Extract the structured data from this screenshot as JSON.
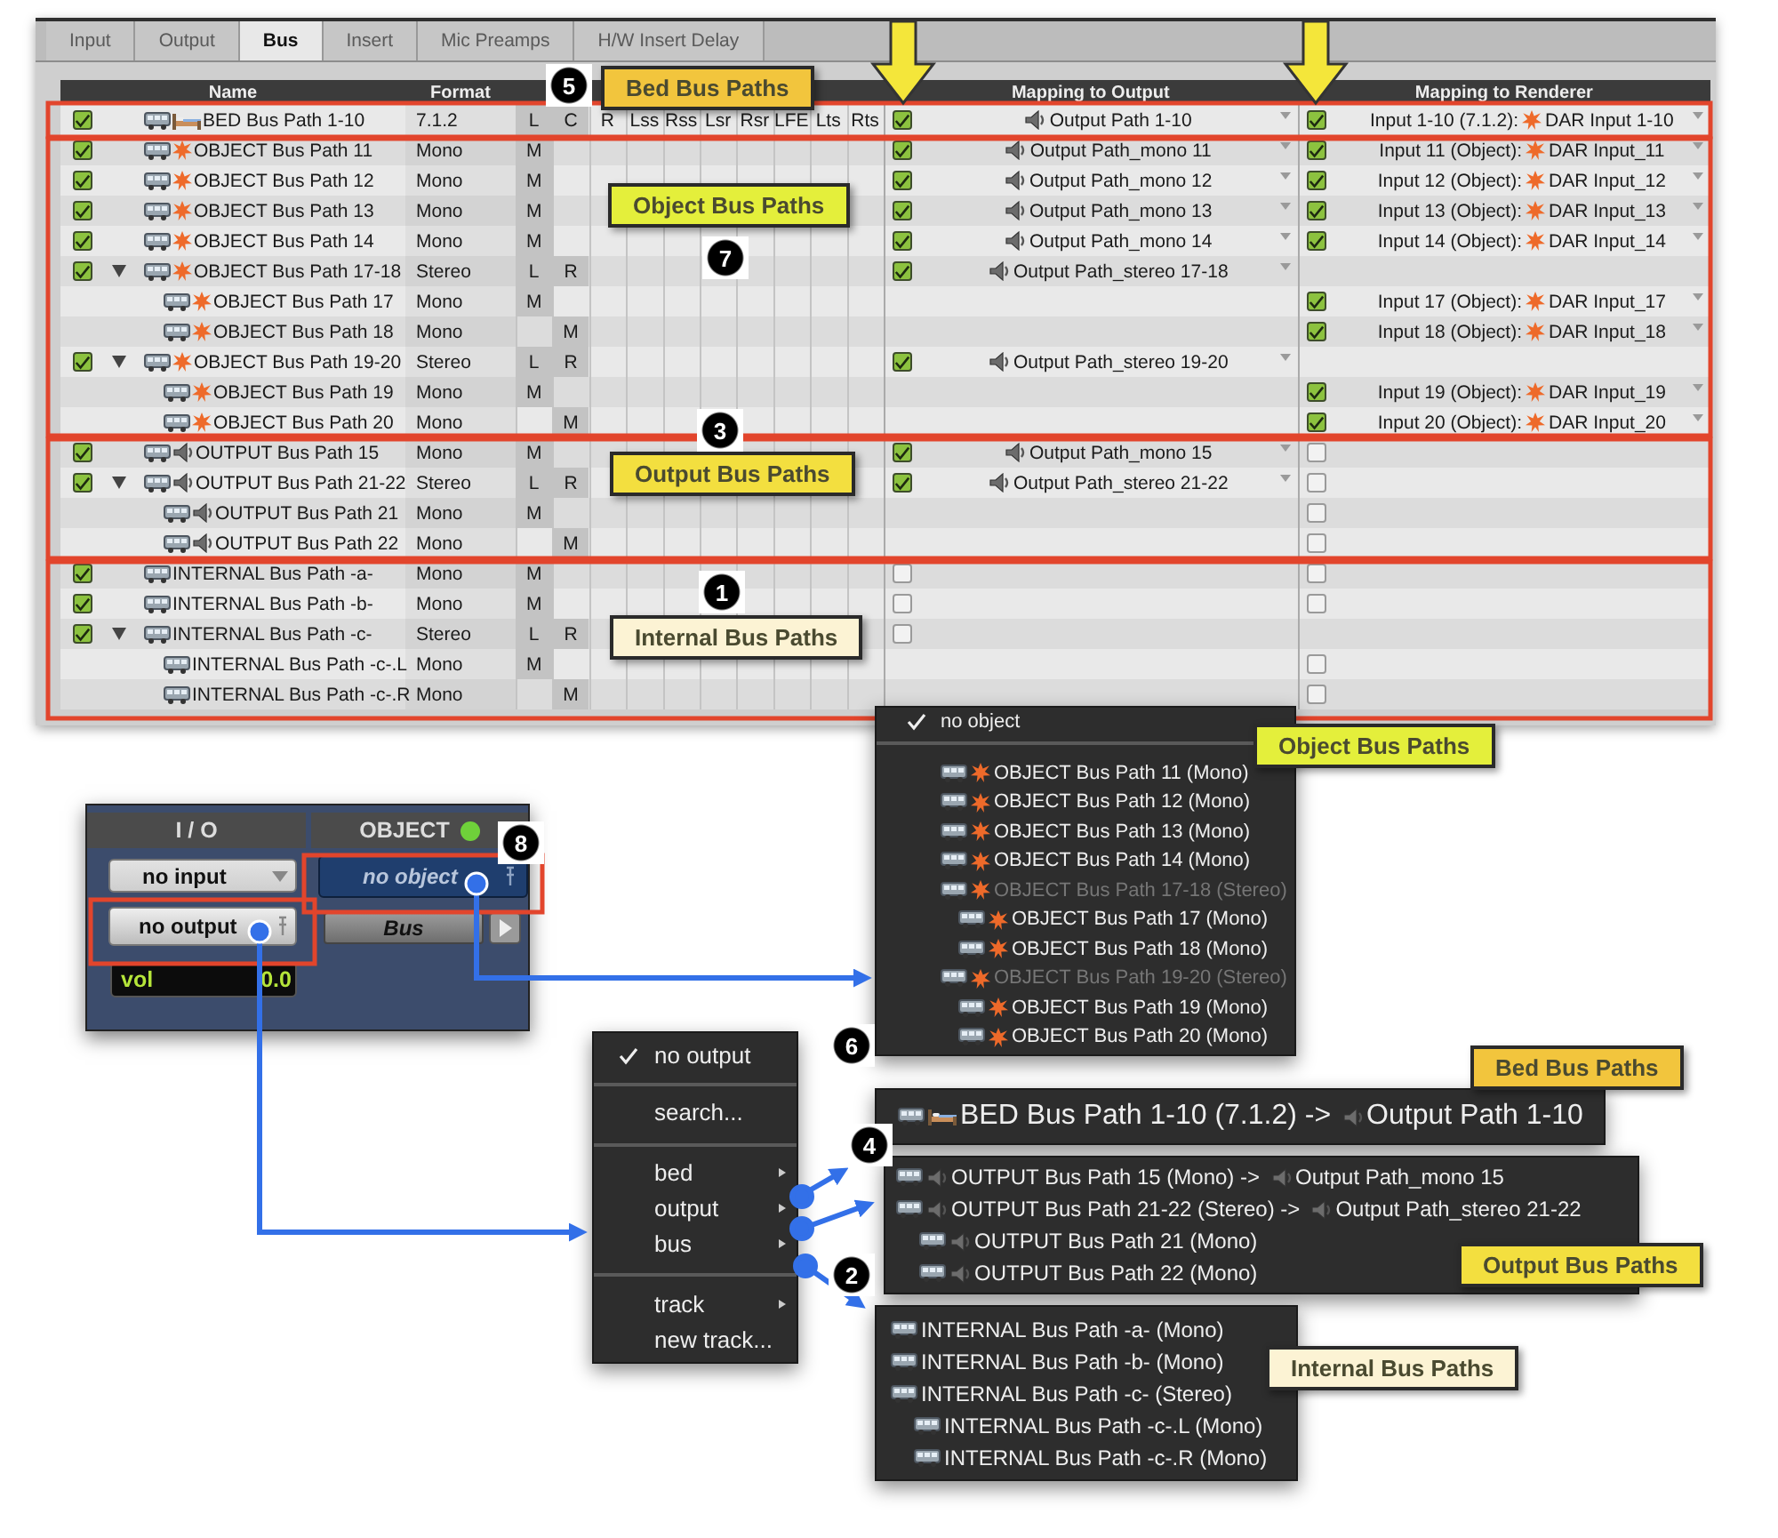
{
  "tabs": [
    {
      "label": "Input",
      "selected": false
    },
    {
      "label": "Output",
      "selected": false
    },
    {
      "label": "Bus",
      "selected": true
    },
    {
      "label": "Insert",
      "selected": false
    },
    {
      "label": "Mic Preamps",
      "selected": false
    },
    {
      "label": "H/W Insert Delay",
      "selected": false
    }
  ],
  "table": {
    "columns": [
      "Name",
      "Format",
      "Mapping to Output",
      "Mapping to Renderer"
    ],
    "rows": [
      {
        "kind": "bed",
        "checked": true,
        "name": "BED Bus Path 1-10",
        "format": "7.1.2",
        "channels": [
          {
            "label": "L",
            "active": true
          },
          {
            "label": "C",
            "active": true
          },
          {
            "label": "R",
            "active": false
          },
          {
            "label": "Lss",
            "active": false
          },
          {
            "label": "Rss",
            "active": false
          },
          {
            "label": "Lsr",
            "active": false
          },
          {
            "label": "Rsr",
            "active": false
          },
          {
            "label": "LFE",
            "active": false
          },
          {
            "label": "Lts",
            "active": false
          },
          {
            "label": "Rts",
            "active": false
          }
        ],
        "output_checked": true,
        "output": "Output Path 1-10",
        "renderer_checked": true,
        "renderer_input": "Input 1-10 (7.1.2):",
        "renderer_target": "DAR Input 1-10"
      },
      {
        "kind": "object",
        "checked": true,
        "name": "OBJECT Bus Path 11",
        "format": "Mono",
        "channels": [
          {
            "label": "M",
            "active": true
          }
        ],
        "output_checked": true,
        "output": "Output Path_mono 11",
        "renderer_checked": true,
        "renderer_input": "Input 11 (Object):",
        "renderer_target": "DAR Input_11"
      },
      {
        "kind": "object",
        "checked": true,
        "name": "OBJECT Bus Path 12",
        "format": "Mono",
        "channels": [
          {
            "label": "M",
            "active": true
          }
        ],
        "output_checked": true,
        "output": "Output Path_mono 12",
        "renderer_checked": true,
        "renderer_input": "Input 12 (Object):",
        "renderer_target": "DAR Input_12"
      },
      {
        "kind": "object",
        "checked": true,
        "name": "OBJECT Bus Path 13",
        "format": "Mono",
        "channels": [
          {
            "label": "M",
            "active": true
          }
        ],
        "output_checked": true,
        "output": "Output Path_mono 13",
        "renderer_checked": true,
        "renderer_input": "Input 13 (Object):",
        "renderer_target": "DAR Input_13"
      },
      {
        "kind": "object",
        "checked": true,
        "name": "OBJECT Bus Path 14",
        "format": "Mono",
        "channels": [
          {
            "label": "M",
            "active": true
          }
        ],
        "output_checked": true,
        "output": "Output Path_mono 14",
        "renderer_checked": true,
        "renderer_input": "Input 14 (Object):",
        "renderer_target": "DAR Input_14"
      },
      {
        "kind": "object",
        "checked": true,
        "expanded": true,
        "name": "OBJECT Bus Path 17-18",
        "format": "Stereo",
        "channels": [
          {
            "label": "L",
            "active": true
          },
          {
            "label": "R",
            "active": true
          }
        ],
        "output_checked": true,
        "output": "Output Path_stereo 17-18",
        "children": [
          {
            "kind": "object",
            "name": "OBJECT Bus Path 17",
            "format": "Mono",
            "channels": [
              {
                "label": "M",
                "active": true
              }
            ],
            "renderer_checked": true,
            "renderer_input": "Input 17 (Object):",
            "renderer_target": "DAR Input_17"
          },
          {
            "kind": "object",
            "name": "OBJECT Bus Path 18",
            "format": "Mono",
            "channels": [
              {
                "label": "M",
                "active": true,
                "after_gap": true
              }
            ],
            "renderer_checked": true,
            "renderer_input": "Input 18 (Object):",
            "renderer_target": "DAR Input_18"
          }
        ]
      },
      {
        "kind": "object",
        "checked": true,
        "expanded": true,
        "name": "OBJECT Bus Path 19-20",
        "format": "Stereo",
        "channels": [
          {
            "label": "L",
            "active": true
          },
          {
            "label": "R",
            "active": true
          }
        ],
        "output_checked": true,
        "output": "Output Path_stereo 19-20",
        "children": [
          {
            "kind": "object",
            "name": "OBJECT Bus Path 19",
            "format": "Mono",
            "channels": [
              {
                "label": "M",
                "active": true
              }
            ],
            "renderer_checked": true,
            "renderer_input": "Input 19 (Object):",
            "renderer_target": "DAR Input_19"
          },
          {
            "kind": "object",
            "name": "OBJECT Bus Path 20",
            "format": "Mono",
            "channels": [
              {
                "label": "M",
                "active": true,
                "after_gap": true
              }
            ],
            "renderer_checked": true,
            "renderer_input": "Input 20 (Object):",
            "renderer_target": "DAR Input_20"
          }
        ]
      },
      {
        "kind": "output",
        "checked": true,
        "name": "OUTPUT Bus Path 15",
        "format": "Mono",
        "channels": [
          {
            "label": "M",
            "active": true
          }
        ],
        "output_checked": true,
        "output": "Output Path_mono 15",
        "renderer_checked": false
      },
      {
        "kind": "output",
        "checked": true,
        "expanded": true,
        "name": "OUTPUT Bus Path 21-22",
        "format": "Stereo",
        "channels": [
          {
            "label": "L",
            "active": true
          },
          {
            "label": "R",
            "active": true
          }
        ],
        "output_checked": true,
        "output": "Output Path_stereo 21-22",
        "renderer_checked": false,
        "children": [
          {
            "kind": "output",
            "name": "OUTPUT Bus Path 21",
            "format": "Mono",
            "channels": [
              {
                "label": "M",
                "active": true
              }
            ],
            "renderer_checked": false
          },
          {
            "kind": "output",
            "name": "OUTPUT Bus Path 22",
            "format": "Mono",
            "channels": [
              {
                "label": "M",
                "active": true,
                "after_gap": true
              }
            ],
            "renderer_checked": false
          }
        ]
      },
      {
        "kind": "internal",
        "checked": true,
        "name": "INTERNAL Bus Path -a-",
        "format": "Mono",
        "channels": [
          {
            "label": "M",
            "active": true
          }
        ],
        "output_checked": false,
        "renderer_checked": false
      },
      {
        "kind": "internal",
        "checked": true,
        "name": "INTERNAL Bus Path -b-",
        "format": "Mono",
        "channels": [
          {
            "label": "M",
            "active": true
          }
        ],
        "output_checked": false,
        "renderer_checked": false
      },
      {
        "kind": "internal",
        "checked": true,
        "expanded": true,
        "name": "INTERNAL Bus Path -c-",
        "format": "Stereo",
        "channels": [
          {
            "label": "L",
            "active": true
          },
          {
            "label": "R",
            "active": true
          }
        ],
        "output_checked": false,
        "children": [
          {
            "kind": "internal",
            "name": "INTERNAL Bus Path -c-.L",
            "format": "Mono",
            "channels": [
              {
                "label": "M",
                "active": true
              }
            ],
            "renderer_checked": false
          },
          {
            "kind": "internal",
            "name": "INTERNAL Bus Path -c-.R",
            "format": "Mono",
            "channels": [
              {
                "label": "M",
                "active": true,
                "after_gap": true
              }
            ],
            "renderer_checked": false
          }
        ]
      }
    ]
  },
  "io_panel": {
    "io_header": "I / O",
    "object_header": "OBJECT",
    "object_on": true,
    "input": "no input",
    "output": "no output",
    "object": "no object",
    "bus": "Bus",
    "volume_label": "vol",
    "volume": "0.0"
  },
  "object_menu": {
    "sections": [
      {
        "items": [
          {
            "label": "no object",
            "checked": true
          }
        ]
      },
      {
        "items": [
          {
            "kind": "object",
            "label": "OBJECT Bus Path 11 (Mono)",
            "checked": false,
            "disabled": false
          },
          {
            "kind": "object",
            "label": "OBJECT Bus Path 12 (Mono)",
            "checked": false,
            "disabled": false
          },
          {
            "kind": "object",
            "label": "OBJECT Bus Path 13 (Mono)",
            "checked": false,
            "disabled": false
          },
          {
            "kind": "object",
            "label": "OBJECT Bus Path 14 (Mono)",
            "checked": false,
            "disabled": false
          },
          {
            "kind": "object",
            "label": "OBJECT Bus Path 17-18 (Stereo)",
            "checked": false,
            "disabled": true,
            "children": [
              {
                "kind": "object",
                "label": "OBJECT Bus Path 17 (Mono)",
                "checked": false,
                "disabled": false
              },
              {
                "kind": "object",
                "label": "OBJECT Bus Path 18 (Mono)",
                "checked": false,
                "disabled": false
              }
            ]
          },
          {
            "kind": "object",
            "label": "OBJECT Bus Path 19-20 (Stereo)",
            "checked": false,
            "disabled": true,
            "children": [
              {
                "kind": "object",
                "label": "OBJECT Bus Path 19 (Mono)",
                "checked": false,
                "disabled": false
              },
              {
                "kind": "object",
                "label": "OBJECT Bus Path 20 (Mono)",
                "checked": false,
                "disabled": false
              }
            ]
          }
        ]
      }
    ]
  },
  "output_menu": {
    "sections": [
      {
        "items": [
          {
            "label": "no output",
            "checked": true,
            "submenu": false
          }
        ]
      },
      {
        "items": [
          {
            "label": "search...",
            "checked": false,
            "submenu": false
          }
        ]
      },
      {
        "items": [
          {
            "label": "bed",
            "checked": false,
            "submenu": true
          },
          {
            "label": "output",
            "checked": false,
            "submenu": true
          },
          {
            "label": "bus",
            "checked": false,
            "submenu": true
          }
        ]
      },
      {
        "items": [
          {
            "label": "track",
            "checked": false,
            "submenu": true
          },
          {
            "label": "new track...",
            "checked": false,
            "submenu": false
          }
        ]
      }
    ]
  },
  "bed_submenu": {
    "sections": [
      {
        "items": [
          {
            "kind": "bed",
            "label": "BED Bus Path 1-10 (7.1.2) ->",
            "target": "Output Path 1-10"
          }
        ]
      }
    ]
  },
  "output_submenu": {
    "sections": [
      {
        "items": [
          {
            "kind": "output",
            "label": "OUTPUT Bus Path 15 (Mono) ->",
            "target": "Output Path_mono 15"
          },
          {
            "kind": "output",
            "label": "OUTPUT Bus Path 21-22 (Stereo) ->",
            "target": "Output Path_stereo 21-22",
            "children": [
              {
                "kind": "output",
                "label": "OUTPUT Bus Path 21 (Mono)"
              },
              {
                "kind": "output",
                "label": "OUTPUT Bus Path 22 (Mono)"
              }
            ]
          }
        ]
      }
    ]
  },
  "bus_submenu": {
    "sections": [
      {
        "items": [
          {
            "kind": "internal",
            "label": "INTERNAL Bus Path -a- (Mono)"
          },
          {
            "kind": "internal",
            "label": "INTERNAL Bus Path -b- (Mono)"
          },
          {
            "kind": "internal",
            "label": "INTERNAL Bus Path -c- (Stereo)",
            "children": [
              {
                "kind": "internal",
                "label": "INTERNAL Bus Path -c-.L (Mono)"
              },
              {
                "kind": "internal",
                "label": "INTERNAL Bus Path -c-.R (Mono)"
              }
            ]
          }
        ]
      }
    ]
  },
  "callouts": [
    {
      "text": "Bed Bus Paths",
      "color": "#f2c53d"
    },
    {
      "text": "Object Bus Paths",
      "color": "#e4ef3b"
    },
    {
      "text": "Output Bus Paths",
      "color": "#f3df3f"
    },
    {
      "text": "Internal Bus Paths",
      "color": "#fcf3d4"
    },
    {
      "text": "Object Bus Paths",
      "color": "#e4ef3b"
    },
    {
      "text": "Bed Bus Paths",
      "color": "#f2c53d"
    },
    {
      "text": "Output Bus Paths",
      "color": "#f3df3f"
    },
    {
      "text": "Internal Bus Paths",
      "color": "#fcf3d4"
    }
  ],
  "markers": [
    {
      "number": "5"
    },
    {
      "number": "7"
    },
    {
      "number": "3"
    },
    {
      "number": "1"
    },
    {
      "number": "8"
    },
    {
      "number": "6"
    },
    {
      "number": "4"
    },
    {
      "number": "2"
    }
  ]
}
